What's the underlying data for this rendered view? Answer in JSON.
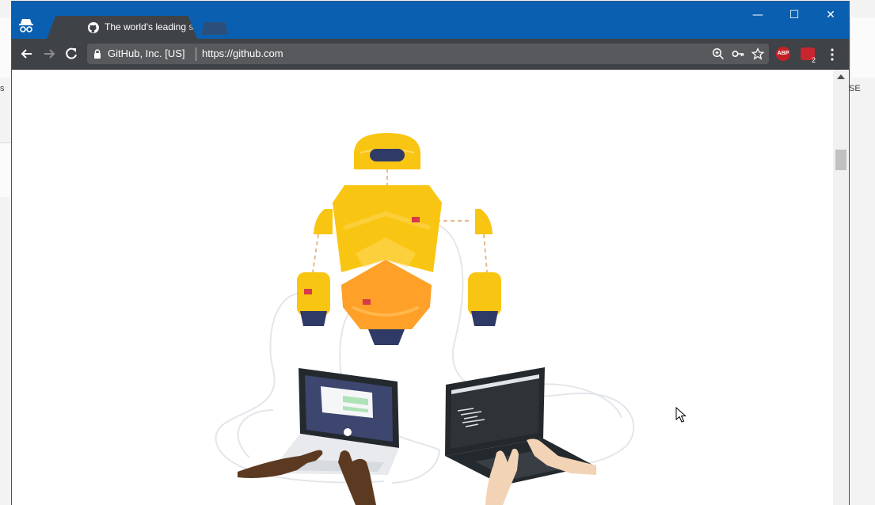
{
  "browser": {
    "tab": {
      "title": "The world's leading software development platform · GitHub",
      "close_glyph": "×"
    },
    "window_controls": {
      "minimize": "—",
      "maximize": "☐",
      "close": "✕"
    },
    "address_bar": {
      "security_label": "GitHub, Inc. [US]",
      "url": "https://github.com"
    },
    "omnibox_icons": [
      "zoom-icon",
      "key-icon",
      "star-icon"
    ],
    "extensions": [
      {
        "name": "adblock-plus",
        "label": "ABP"
      },
      {
        "name": "extension-badge",
        "badge": "2"
      }
    ]
  },
  "backdrop": {
    "left_fragment": "s",
    "right_fragment": "SE"
  },
  "page": {
    "illustration": "github-robot-with-laptops"
  },
  "colors": {
    "titlebar": "#0b5fb0",
    "toolbar": "#3f4246",
    "robot_yellow": "#f9c513",
    "robot_orange": "#ffa028",
    "robot_navy": "#2f3a66"
  }
}
